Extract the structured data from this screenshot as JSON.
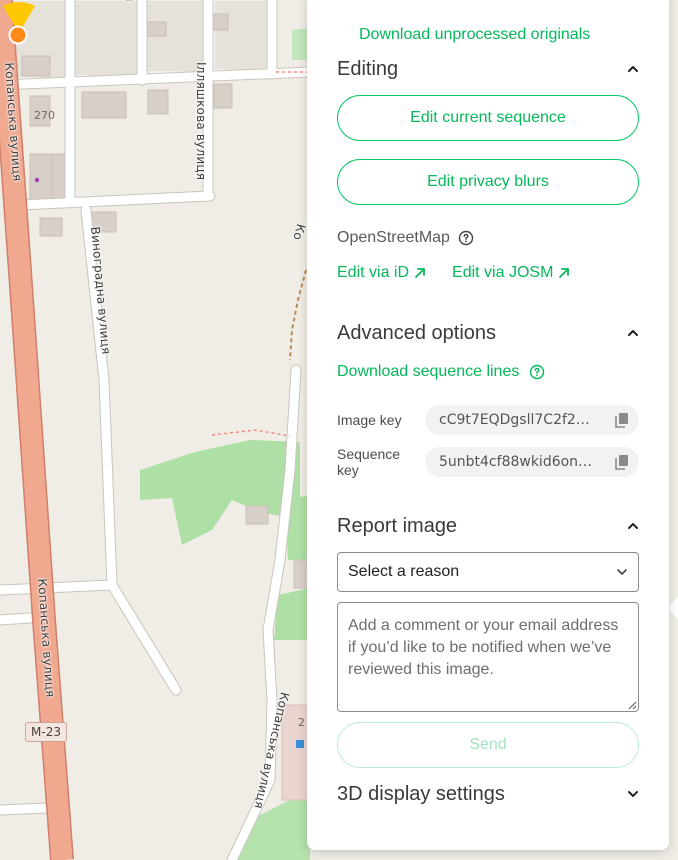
{
  "map": {
    "streets": {
      "kopanska_vertical_top": "Копанська вулиця",
      "vynohradna": "Виноградна вулиця",
      "illyashkova": "Ілляшкова вулиця",
      "kopanska_lower": "Копанська вулиця",
      "kopanska_right": "Копанська вулиця",
      "ko_partial": "Ко",
      "top_partial": "я"
    },
    "house_number_270": "270",
    "house_number_partial": "2",
    "road_shield": "M-23"
  },
  "panel": {
    "download_originals": "Download unprocessed originals",
    "editing": {
      "title": "Editing",
      "edit_sequence": "Edit current sequence",
      "edit_blurs": "Edit privacy blurs",
      "osm_label": "OpenStreetMap",
      "edit_id": "Edit via iD",
      "edit_josm": "Edit via JOSM"
    },
    "advanced": {
      "title": "Advanced options",
      "download_lines": "Download sequence lines",
      "image_key_label": "Image key",
      "image_key_value": "cC9t7EQDgsll7C2f2…",
      "sequence_key_label": "Sequence key",
      "sequence_key_value": "5unbt4cf88wkid6on…"
    },
    "report": {
      "title": "Report image",
      "reason_select": "Select a reason",
      "comment_placeholder": "Add a comment or your email address if you’d like to be notified when we’ve reviewed this image.",
      "send": "Send"
    },
    "display3d": {
      "title": "3D display settings"
    }
  },
  "colors": {
    "accent_green": "#05cb63",
    "primary_road": "#e9a28c",
    "park": "#a9e0a4",
    "marker_orange": "#ff8a1c",
    "marker_fov": "#ffc800"
  },
  "icons": {
    "chevron_up": "chevron-up-icon",
    "chevron_down": "chevron-down-icon",
    "help": "help-circle-icon",
    "external": "arrow-up-right-icon",
    "copy": "copy-icon"
  }
}
